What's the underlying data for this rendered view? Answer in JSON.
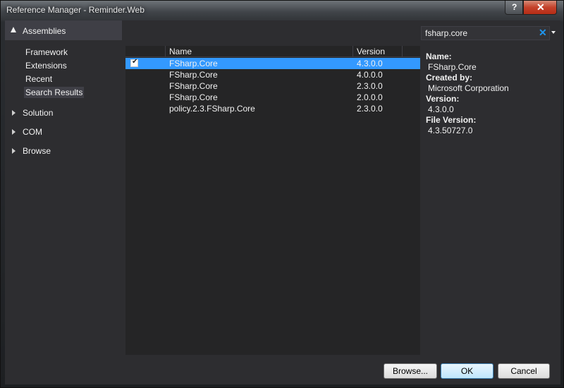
{
  "window": {
    "title": "Reference Manager - Reminder.Web",
    "help_glyph": "?",
    "close_glyph": "✕"
  },
  "nav": {
    "header": "Assemblies",
    "items": [
      "Framework",
      "Extensions",
      "Recent",
      "Search Results"
    ],
    "selected_item": "Search Results",
    "groups": [
      "Solution",
      "COM",
      "Browse"
    ]
  },
  "search": {
    "value": "fsharp.core",
    "clear_glyph": "✕"
  },
  "list": {
    "columns": [
      "Name",
      "Version"
    ],
    "rows": [
      {
        "checked": true,
        "name": "FSharp.Core",
        "version": "4.3.0.0",
        "selected": true
      },
      {
        "checked": false,
        "name": "FSharp.Core",
        "version": "4.0.0.0",
        "selected": false
      },
      {
        "checked": false,
        "name": "FSharp.Core",
        "version": "2.3.0.0",
        "selected": false
      },
      {
        "checked": false,
        "name": "FSharp.Core",
        "version": "2.0.0.0",
        "selected": false
      },
      {
        "checked": false,
        "name": "policy.2.3.FSharp.Core",
        "version": "2.3.0.0",
        "selected": false
      }
    ]
  },
  "details": {
    "name_label": "Name:",
    "name_value": "FSharp.Core",
    "created_label": "Created by:",
    "created_value": "Microsoft Corporation",
    "version_label": "Version:",
    "version_value": "4.3.0.0",
    "file_version_label": "File Version:",
    "file_version_value": "4.3.50727.0"
  },
  "buttons": {
    "browse": "Browse...",
    "ok": "OK",
    "cancel": "Cancel"
  },
  "colors": {
    "selection": "#3399ff",
    "accent": "#1e96f0"
  }
}
